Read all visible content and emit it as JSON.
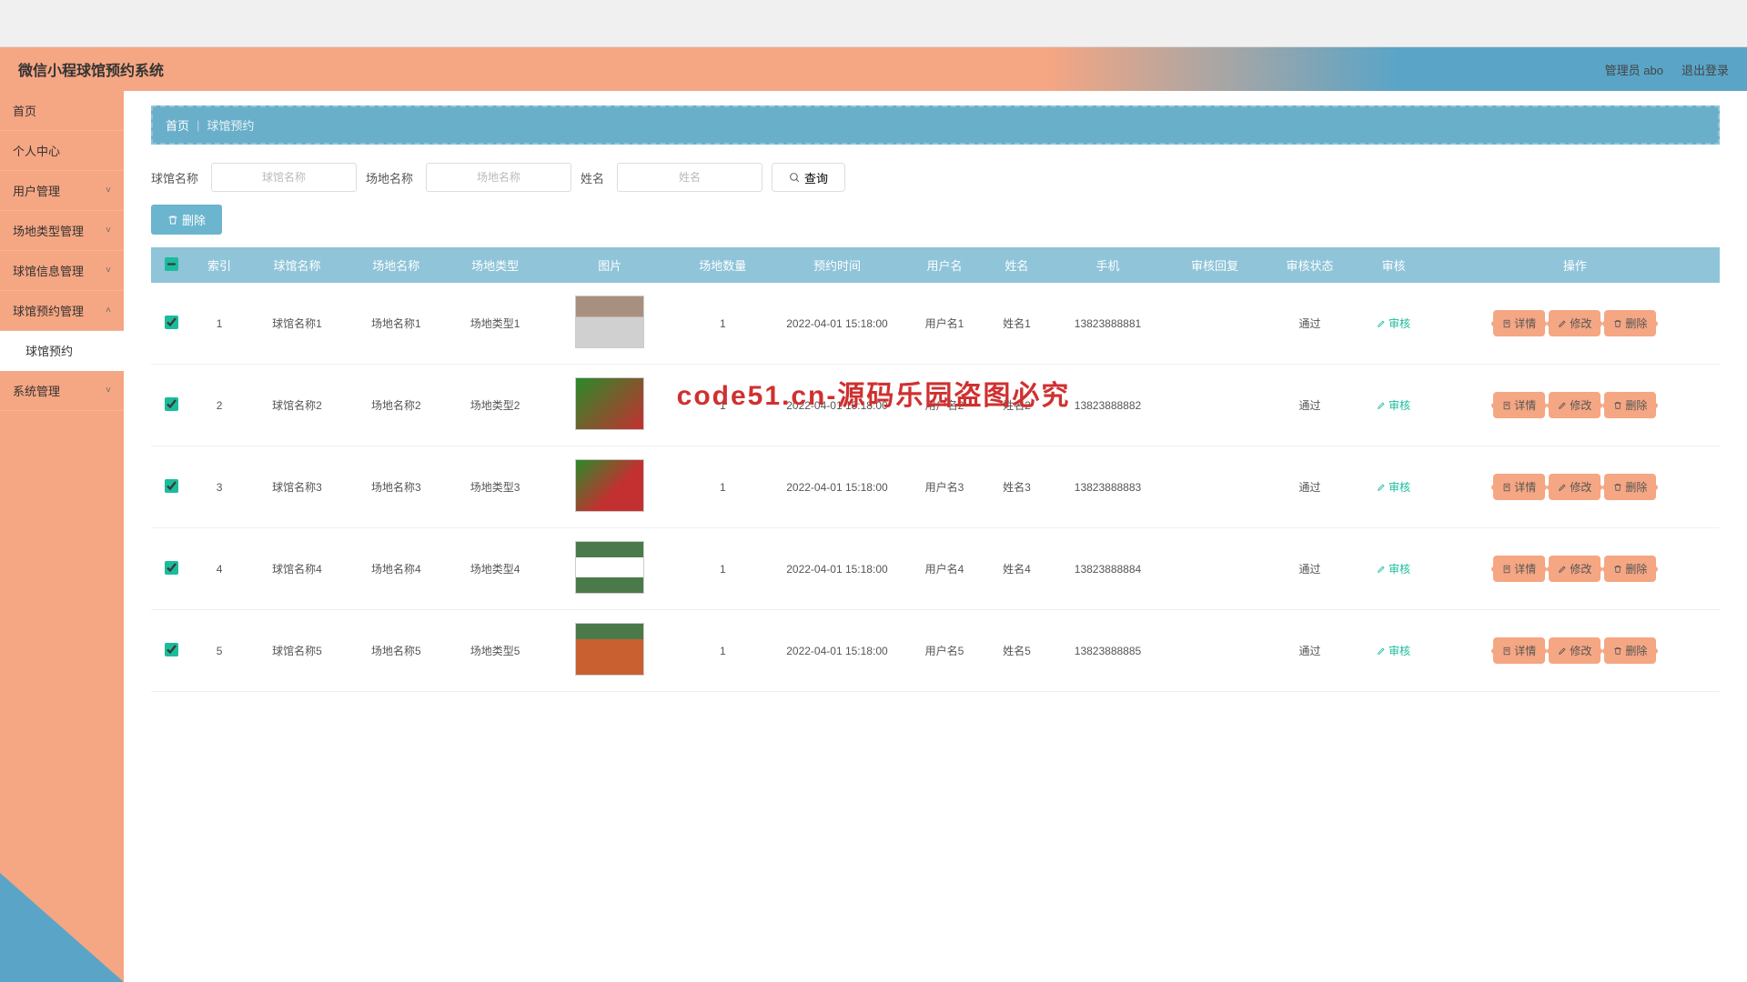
{
  "header": {
    "title": "微信小程球馆预约系统",
    "user": "管理员 abo",
    "logout": "退出登录"
  },
  "sidebar": [
    {
      "label": "首页",
      "expandable": false
    },
    {
      "label": "个人中心",
      "expandable": false
    },
    {
      "label": "用户管理",
      "expandable": true
    },
    {
      "label": "场地类型管理",
      "expandable": true
    },
    {
      "label": "球馆信息管理",
      "expandable": true
    },
    {
      "label": "球馆预约管理",
      "expandable": true,
      "open": true
    },
    {
      "label": "球馆预约",
      "sub": true,
      "active": true
    },
    {
      "label": "系统管理",
      "expandable": true
    }
  ],
  "breadcrumb": {
    "home": "首页",
    "sep": "|",
    "current": "球馆预约"
  },
  "search": {
    "f1_label": "球馆名称",
    "f1_ph": "球馆名称",
    "f2_label": "场地名称",
    "f2_ph": "场地名称",
    "f3_label": "姓名",
    "f3_ph": "姓名",
    "btn": "查询"
  },
  "toolbar": {
    "delete": "删除"
  },
  "columns": [
    "",
    "索引",
    "球馆名称",
    "场地名称",
    "场地类型",
    "图片",
    "场地数量",
    "预约时间",
    "用户名",
    "姓名",
    "手机",
    "审核回复",
    "审核状态",
    "审核",
    "操作"
  ],
  "row_actions": {
    "audit": "审核",
    "detail": "详情",
    "edit": "修改",
    "delete": "删除"
  },
  "rows": [
    {
      "idx": "1",
      "gym": "球馆名称1",
      "field": "场地名称1",
      "type": "场地类型1",
      "thumb": "t1",
      "qty": "1",
      "time": "2022-04-01 15:18:00",
      "user": "用户名1",
      "name": "姓名1",
      "phone": "13823888881",
      "reply": "",
      "status": "通过"
    },
    {
      "idx": "2",
      "gym": "球馆名称2",
      "field": "场地名称2",
      "type": "场地类型2",
      "thumb": "t2",
      "qty": "1",
      "time": "2022-04-01 15:18:00",
      "user": "用户名2",
      "name": "姓名2",
      "phone": "13823888882",
      "reply": "",
      "status": "通过"
    },
    {
      "idx": "3",
      "gym": "球馆名称3",
      "field": "场地名称3",
      "type": "场地类型3",
      "thumb": "t3",
      "qty": "1",
      "time": "2022-04-01 15:18:00",
      "user": "用户名3",
      "name": "姓名3",
      "phone": "13823888883",
      "reply": "",
      "status": "通过"
    },
    {
      "idx": "4",
      "gym": "球馆名称4",
      "field": "场地名称4",
      "type": "场地类型4",
      "thumb": "t4",
      "qty": "1",
      "time": "2022-04-01 15:18:00",
      "user": "用户名4",
      "name": "姓名4",
      "phone": "13823888884",
      "reply": "",
      "status": "通过"
    },
    {
      "idx": "5",
      "gym": "球馆名称5",
      "field": "场地名称5",
      "type": "场地类型5",
      "thumb": "t5",
      "qty": "1",
      "time": "2022-04-01 15:18:00",
      "user": "用户名5",
      "name": "姓名5",
      "phone": "13823888885",
      "reply": "",
      "status": "通过"
    }
  ],
  "watermark_big": "code51.cn-源码乐园盗图必究"
}
